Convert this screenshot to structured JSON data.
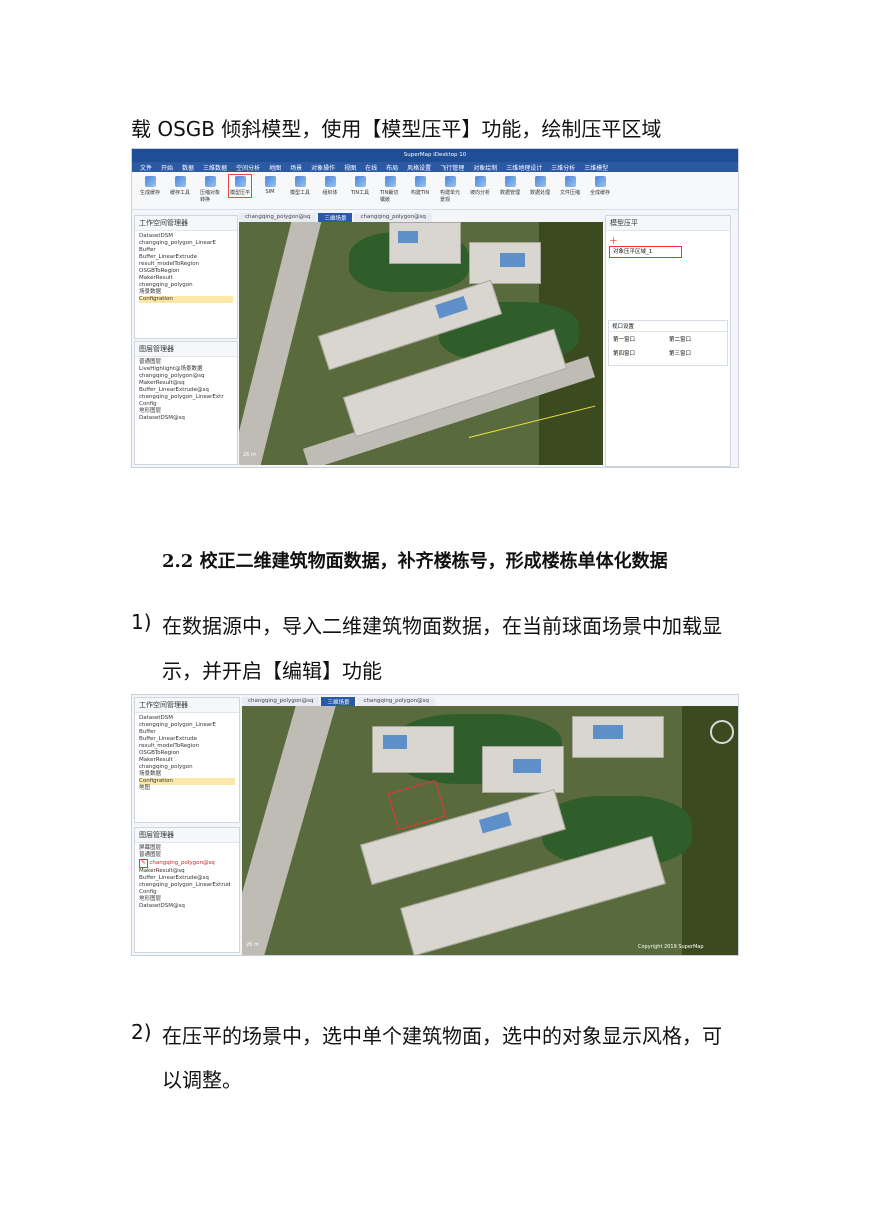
{
  "doc": {
    "line1": "载 OSGB 倾斜模型，使用【模型压平】功能，绘制压平区域",
    "heading": "2.2 校正二维建筑物面数据，补齐楼栋号，形成楼栋单体化数据",
    "item1_num": "1)",
    "item1_line1": "在数据源中，导入二维建筑物面数据，在当前球面场景中加载显",
    "item1_line2": "示，并开启【编辑】功能",
    "item2_num": "2)",
    "item2_line1": "在压平的场景中，选中单个建筑物面，选中的对象显示风格，可",
    "item2_line2": "以调整。"
  },
  "shot1": {
    "app_title": "SuperMap iDesktop 10",
    "menu": [
      "文件",
      "开始",
      "数据",
      "三维数据",
      "空间分析",
      "地图",
      "场景",
      "对象操作",
      "视图",
      "在线",
      "布局",
      "风格设置",
      "飞行管理",
      "对象绘制",
      "三维地理设计",
      "三维分析",
      "三维模型"
    ],
    "toolbar": [
      "生成缓存",
      "缓存工具",
      "压缩对象转换",
      "模型压平",
      "SIM",
      "模型工具",
      "组织体",
      "TIN工具",
      "TIN裁切镶嵌",
      "构建TIN",
      "构建单元景观",
      "坡向分析",
      "数据管理",
      "数据处理",
      "文件压缩",
      "全成缓存"
    ],
    "tabs": [
      "changqing_polygon@sq",
      "三维场景",
      "changqing_polygon@sq"
    ],
    "workspace_title": "工作空间管理器",
    "workspace_tree": [
      "DatasetDSM",
      "changqing_polygon_LinearE",
      "Buffer",
      "Buffer_LinearExtrude",
      "result_modelToRegion",
      "OSGBToRegion",
      "MakerResult",
      "changqing_polygon",
      "场景数据",
      "Configration"
    ],
    "layer_title": "图层管理器",
    "layer_tree": [
      "普通图层",
      "LiveHighlight@场景数据",
      "changqing_polygon@sq",
      "MakerResult@sq",
      "Buffer_LinearExtrude@sq",
      "changqing_polygon_LinearExtr",
      "Config",
      "地形图层",
      "DatasetDSM@sq"
    ],
    "right_panel_title": "模型压平",
    "right_item": "对象压平区域_1",
    "view_title": "视口设置",
    "views": [
      "第一窗口",
      "第二窗口",
      "第四窗口",
      "第三窗口"
    ],
    "scale": "26 m"
  },
  "shot2": {
    "tabs": [
      "changqing_polygon@sq",
      "三维场景",
      "changqing_polygon@sq"
    ],
    "workspace_title": "工作空间管理器",
    "workspace_tree": [
      "DatasetDSM",
      "changqing_polygon_LinearE",
      "Buffer",
      "Buffer_LinearExtrude",
      "result_modelToRegion",
      "OSGBToRegion",
      "MakerResult",
      "changqing_polygon",
      "场景数据",
      "Configration",
      "地图"
    ],
    "layer_title": "图层管理器",
    "layer_tree": [
      "屏幕图层",
      "普通图层",
      "changqing_polygon@sq",
      "MakerResult@sq",
      "Buffer_LinearExtrude@sq",
      "changqing_polygon_LinearExtrud",
      "Config",
      "地形图层",
      "DatasetDSM@sq"
    ],
    "copyright": "Copyright 2019 SuperMap",
    "scale": "26 m"
  }
}
